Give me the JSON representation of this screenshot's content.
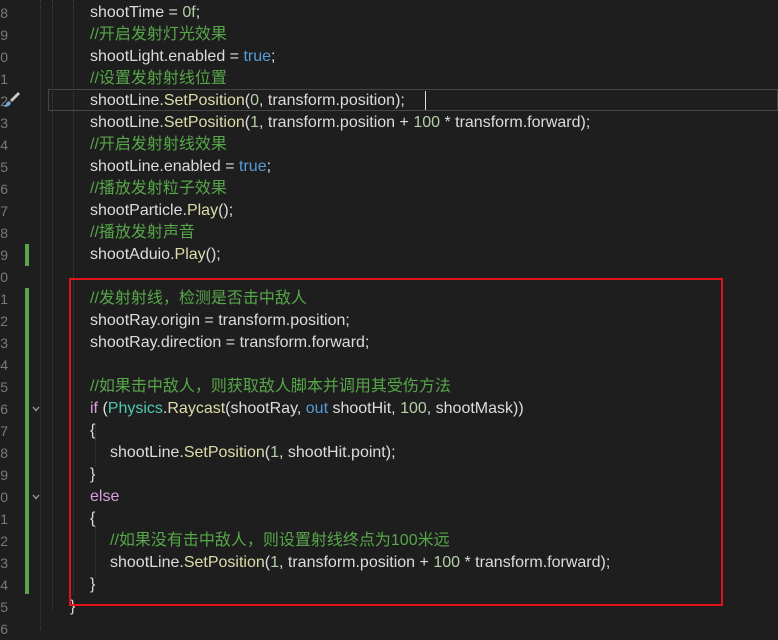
{
  "gutter": [
    "8",
    "9",
    "0",
    "1",
    "2",
    "3",
    "4",
    "5",
    "6",
    "7",
    "8",
    "9",
    "0",
    "1",
    "2",
    "3",
    "4",
    "5",
    "6",
    "7",
    "8",
    "9",
    "0",
    "1",
    "2",
    "3",
    "4",
    "5",
    "6"
  ],
  "lines": [
    [
      [
        "id",
        "shootTime = "
      ],
      [
        "num",
        "0f"
      ],
      [
        "id",
        ";"
      ]
    ],
    [
      [
        "cm",
        "//开启发射灯光效果"
      ]
    ],
    [
      [
        "id",
        "shootLight.enabled = "
      ],
      [
        "kw",
        "true"
      ],
      [
        "id",
        ";"
      ]
    ],
    [
      [
        "cm",
        "//设置发射射线位置"
      ]
    ],
    [
      [
        "id",
        "shootLine."
      ],
      [
        "fn",
        "SetPosition"
      ],
      [
        "id",
        "("
      ],
      [
        "num",
        "0"
      ],
      [
        "id",
        ", transform.position);"
      ]
    ],
    [
      [
        "id",
        "shootLine."
      ],
      [
        "fn",
        "SetPosition"
      ],
      [
        "id",
        "("
      ],
      [
        "num",
        "1"
      ],
      [
        "id",
        ", transform.position + "
      ],
      [
        "num",
        "100"
      ],
      [
        "id",
        " * transform.forward);"
      ]
    ],
    [
      [
        "cm",
        "//开启发射射线效果"
      ]
    ],
    [
      [
        "id",
        "shootLine.enabled = "
      ],
      [
        "kw",
        "true"
      ],
      [
        "id",
        ";"
      ]
    ],
    [
      [
        "cm",
        "//播放发射粒子效果"
      ]
    ],
    [
      [
        "id",
        "shootParticle."
      ],
      [
        "fn",
        "Play"
      ],
      [
        "id",
        "();"
      ]
    ],
    [
      [
        "cm",
        "//播放发射声音"
      ]
    ],
    [
      [
        "id",
        "shootAduio."
      ],
      [
        "fn",
        "Play"
      ],
      [
        "id",
        "();"
      ]
    ],
    [],
    [
      [
        "cm",
        "//发射射线，检测是否击中敌人"
      ]
    ],
    [
      [
        "id",
        "shootRay.origin = transform.position;"
      ]
    ],
    [
      [
        "id",
        "shootRay.direction = transform.forward;"
      ]
    ],
    [],
    [
      [
        "cm",
        "//如果击中敌人，则获取敌人脚本并调用其受伤方法"
      ]
    ],
    [
      [
        "kw2",
        "if"
      ],
      [
        "id",
        " ("
      ],
      [
        "cls",
        "Physics"
      ],
      [
        "id",
        "."
      ],
      [
        "fn",
        "Raycast"
      ],
      [
        "id",
        "(shootRay, "
      ],
      [
        "kw",
        "out"
      ],
      [
        "id",
        " shootHit, "
      ],
      [
        "num",
        "100"
      ],
      [
        "id",
        ", shootMask))"
      ]
    ],
    [
      [
        "id",
        "{"
      ]
    ],
    [
      [
        "id",
        "shootLine."
      ],
      [
        "fn",
        "SetPosition"
      ],
      [
        "id",
        "("
      ],
      [
        "num",
        "1"
      ],
      [
        "id",
        ", shootHit.point);"
      ]
    ],
    [
      [
        "id",
        "}"
      ]
    ],
    [
      [
        "kw2",
        "else"
      ]
    ],
    [
      [
        "id",
        "{"
      ]
    ],
    [
      [
        "cm",
        "//如果没有击中敌人，则设置射线终点为100米远"
      ]
    ],
    [
      [
        "id",
        "shootLine."
      ],
      [
        "fn",
        "SetPosition"
      ],
      [
        "id",
        "("
      ],
      [
        "num",
        "1"
      ],
      [
        "id",
        ", transform.position + "
      ],
      [
        "num",
        "100"
      ],
      [
        "id",
        " * transform.forward);"
      ]
    ],
    [
      [
        "id",
        "}"
      ]
    ],
    [
      [
        "id",
        "}"
      ]
    ],
    []
  ],
  "colors": {
    "background": "#1e1e1e",
    "comment": "#57a64a",
    "keyword": "#569cd6",
    "control_keyword": "#d8a0df",
    "method": "#dcdcaa",
    "type": "#4ec9b0",
    "number": "#b5cea8",
    "identifier": "#dcdcdc",
    "highlight_box": "#e0131f"
  },
  "icons": {
    "gutter_glyph": "paintbrush-icon",
    "fold": "chevron-down-icon"
  }
}
